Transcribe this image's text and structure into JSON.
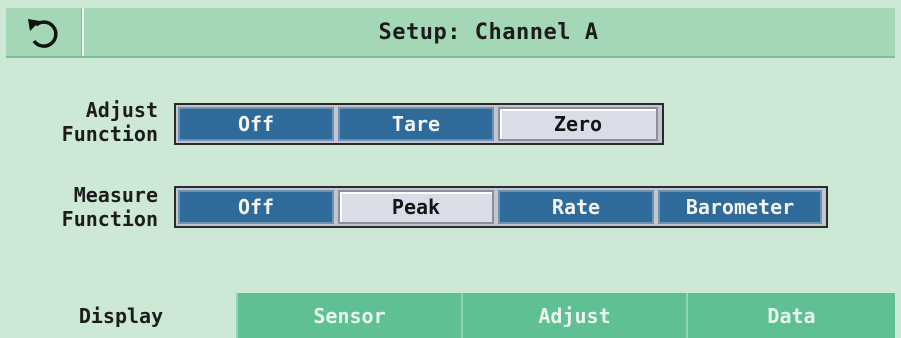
{
  "header": {
    "back_icon": "back-arrow-icon",
    "title": "Setup: Channel A"
  },
  "adjust": {
    "label_line1": "Adjust",
    "label_line2": "Function",
    "options": [
      {
        "label": "Off",
        "selected": false
      },
      {
        "label": "Tare",
        "selected": false
      },
      {
        "label": "Zero",
        "selected": true
      }
    ]
  },
  "measure": {
    "label_line1": "Measure",
    "label_line2": "Function",
    "options": [
      {
        "label": "Off",
        "selected": false
      },
      {
        "label": "Peak",
        "selected": true
      },
      {
        "label": "Rate",
        "selected": false
      },
      {
        "label": "Barometer",
        "selected": false
      }
    ]
  },
  "tabs": [
    {
      "label": "Display",
      "active": true
    },
    {
      "label": "Sensor",
      "active": false
    },
    {
      "label": "Adjust",
      "active": false
    },
    {
      "label": "Data",
      "active": false
    }
  ],
  "colors": {
    "background": "#cde8d5",
    "titlebar": "#a3d7b5",
    "unselected_button": "#2e6a9a",
    "selected_button": "#d8dde8",
    "inactive_tab": "#5fc094"
  }
}
